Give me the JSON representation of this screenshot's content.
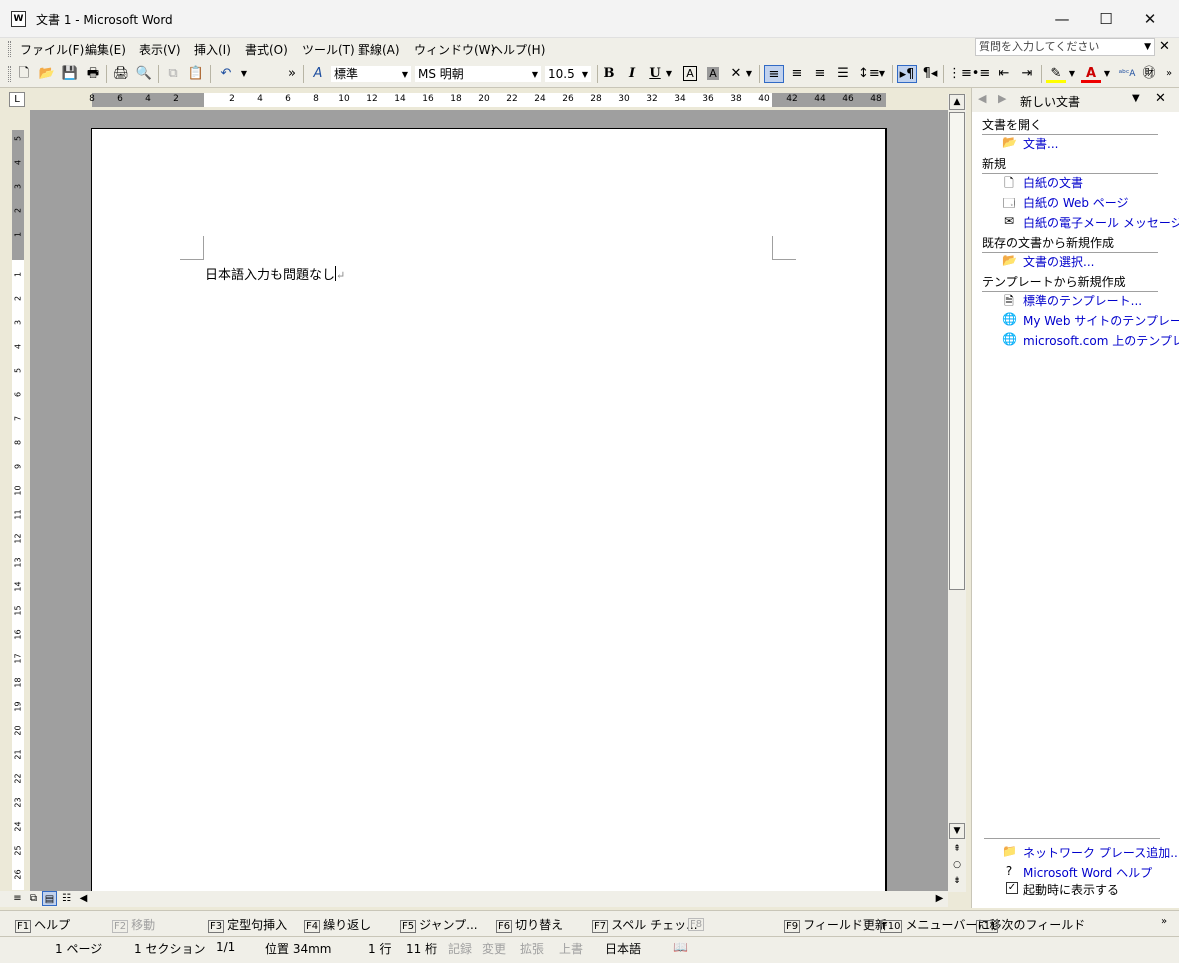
{
  "window": {
    "app_icon_label": "W",
    "title": "文書 1 - Microsoft Word",
    "controls": {
      "minimize": "—",
      "maximize": "☐",
      "close": "✕"
    }
  },
  "menubar": {
    "items": [
      "ファイル(F)",
      "編集(E)",
      "表示(V)",
      "挿入(I)",
      "書式(O)",
      "ツール(T)",
      "罫線(A)",
      "ウィンドウ(W)",
      "ヘルプ(H)"
    ],
    "help_placeholder": "質問を入力してください",
    "close_glyph": "✕"
  },
  "toolbar": {
    "style_value": "標準",
    "font_value": "MS 明朝",
    "size_value": "10.5",
    "bold": "B",
    "italic": "I",
    "underline": "U",
    "more": "»"
  },
  "ruler": {
    "corner": "L",
    "h_ticks": [
      "8",
      "6",
      "4",
      "2",
      "2",
      "4",
      "6",
      "8",
      "10",
      "12",
      "14",
      "16",
      "18",
      "20",
      "22",
      "24",
      "26",
      "28",
      "30",
      "32",
      "34",
      "36",
      "38",
      "40",
      "42",
      "44",
      "46",
      "48"
    ],
    "v_ticks": [
      "5",
      "4",
      "3",
      "2",
      "1",
      "1",
      "2",
      "3",
      "4",
      "5",
      "6",
      "7",
      "8",
      "9",
      "10",
      "11",
      "12",
      "13",
      "14",
      "15",
      "16",
      "17",
      "18",
      "19",
      "20",
      "21",
      "22",
      "23",
      "24",
      "25",
      "26"
    ]
  },
  "document": {
    "text": "日本語入力も問題なし",
    "para_mark": "↵"
  },
  "taskpane": {
    "title": "新しい文書",
    "sections": {
      "open": "文書を開く",
      "new": "新規",
      "from_existing": "既存の文書から新規作成",
      "from_template": "テンプレートから新規作成"
    },
    "links": {
      "open_doc": "文書...",
      "blank_doc": "白紙の文書",
      "blank_web": "白紙の Web ページ",
      "blank_email": "白紙の電子メール メッセージ",
      "choose_doc": "文書の選択...",
      "std_template": "標準のテンプレート...",
      "my_web_template": "My Web サイトのテンプレート...",
      "ms_template": "microsoft.com 上のテンプレート",
      "network_place": "ネットワーク プレース追加...",
      "word_help": "Microsoft Word ヘルプ",
      "show_on_start": "起動時に表示する"
    }
  },
  "fkeys": [
    {
      "key": "F1",
      "label": "ヘルプ",
      "enabled": true
    },
    {
      "key": "F2",
      "label": "移動",
      "enabled": false
    },
    {
      "key": "F3",
      "label": "定型句挿入",
      "enabled": true
    },
    {
      "key": "F4",
      "label": "繰り返し",
      "enabled": true
    },
    {
      "key": "F5",
      "label": "ジャンプ...",
      "enabled": true
    },
    {
      "key": "F6",
      "label": "切り替え",
      "enabled": true
    },
    {
      "key": "F7",
      "label": "スペル チェッ...",
      "enabled": true
    },
    {
      "key": "F8",
      "label": "",
      "enabled": false
    },
    {
      "key": "F9",
      "label": "フィールド更新",
      "enabled": true
    },
    {
      "key": "F10",
      "label": "メニューバーに移",
      "enabled": true
    },
    {
      "key": "F11",
      "label": "次のフィールド",
      "enabled": true
    }
  ],
  "status": {
    "page": "1 ページ",
    "section": "1 セクション",
    "pages": "1/1",
    "position": "位置  34mm",
    "line": "1 行",
    "column": "11 桁",
    "rec": "記録",
    "trk": "変更",
    "ext": "拡張",
    "ovr": "上書",
    "language": "日本語"
  }
}
